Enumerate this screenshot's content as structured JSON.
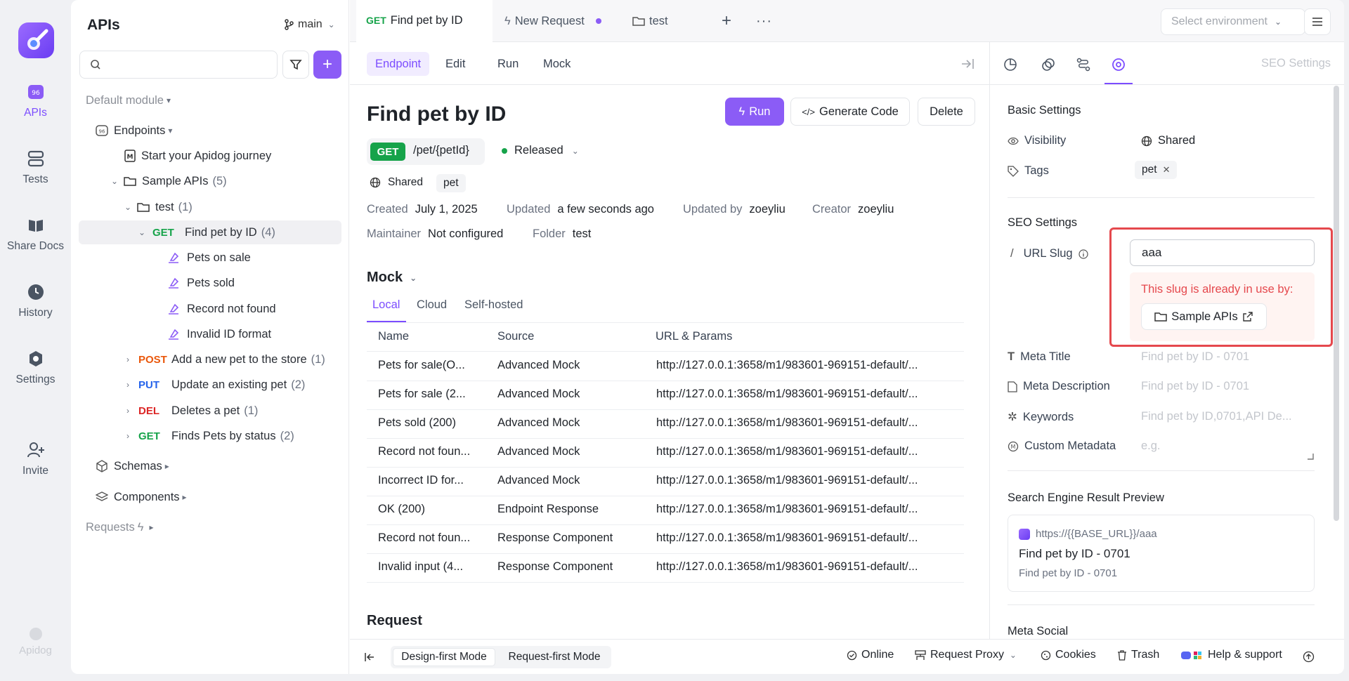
{
  "rail": {
    "items": [
      {
        "label": "APIs",
        "icon": "apis-icon"
      },
      {
        "label": "Tests",
        "icon": "tests-icon"
      },
      {
        "label": "Share Docs",
        "icon": "share-docs-icon"
      },
      {
        "label": "History",
        "icon": "history-icon"
      },
      {
        "label": "Settings",
        "icon": "settings-icon"
      },
      {
        "label": "Invite",
        "icon": "invite-icon"
      }
    ],
    "footer_label": "Apidog"
  },
  "sidebar": {
    "title": "APIs",
    "branch": "main",
    "tree": {
      "default_module": "Default module",
      "endpoints": "Endpoints",
      "journey": "Start your Apidog journey",
      "sample_apis": "Sample APIs",
      "sample_apis_count": "(5)",
      "test": "test",
      "test_count": "(1)",
      "selected_method": "GET",
      "selected_name": "Find pet by ID",
      "selected_count": "(4)",
      "cases": [
        "Pets on sale",
        "Pets sold",
        "Record not found",
        "Invalid ID format"
      ],
      "endpoints_list": [
        {
          "method": "POST",
          "name": "Add a new pet to the store",
          "count": "(1)"
        },
        {
          "method": "PUT",
          "name": "Update an existing pet",
          "count": "(2)"
        },
        {
          "method": "DEL",
          "name": "Deletes a pet",
          "count": "(1)"
        },
        {
          "method": "GET",
          "name": "Finds Pets by status",
          "count": "(2)"
        }
      ],
      "schemas": "Schemas",
      "components": "Components",
      "requests": "Requests"
    }
  },
  "tabs": [
    {
      "method": "GET",
      "label": "Find pet by ID"
    },
    {
      "label": "New Request"
    },
    {
      "label": "test"
    }
  ],
  "env_placeholder": "Select environment",
  "subtabs": [
    "Endpoint",
    "Edit",
    "Run",
    "Mock"
  ],
  "endpoint": {
    "title": "Find pet by ID",
    "run_label": "Run",
    "generate_label": "Generate Code",
    "delete_label": "Delete",
    "method": "GET",
    "path": "/pet/{petId}",
    "status": "Released",
    "visibility": "Shared",
    "tag": "pet",
    "created_k": "Created",
    "created_v": "July 1, 2025",
    "updated_k": "Updated",
    "updated_v": "a few seconds ago",
    "updatedby_k": "Updated by",
    "updatedby_v": "zoeyliu",
    "creator_k": "Creator",
    "creator_v": "zoeyliu",
    "maintainer_k": "Maintainer",
    "maintainer_v": "Not configured",
    "folder_k": "Folder",
    "folder_v": "test"
  },
  "mock": {
    "title": "Mock",
    "tabs": [
      "Local",
      "Cloud",
      "Self-hosted"
    ],
    "headers": [
      "Name",
      "Source",
      "URL & Params"
    ],
    "rows": [
      {
        "name": "Pets for sale(O...",
        "source": "Advanced Mock",
        "url": "http://127.0.0.1:3658/m1/983601-969151-default/..."
      },
      {
        "name": "Pets for sale (2...",
        "source": "Advanced Mock",
        "url": "http://127.0.0.1:3658/m1/983601-969151-default/..."
      },
      {
        "name": "Pets sold (200)",
        "source": "Advanced Mock",
        "url": "http://127.0.0.1:3658/m1/983601-969151-default/..."
      },
      {
        "name": "Record not foun...",
        "source": "Advanced Mock",
        "url": "http://127.0.0.1:3658/m1/983601-969151-default/..."
      },
      {
        "name": "Incorrect ID for...",
        "source": "Advanced Mock",
        "url": "http://127.0.0.1:3658/m1/983601-969151-default/..."
      },
      {
        "name": "OK (200)",
        "source": "Endpoint Response",
        "url": "http://127.0.0.1:3658/m1/983601-969151-default/..."
      },
      {
        "name": "Record not foun...",
        "source": "Response Component",
        "url": "http://127.0.0.1:3658/m1/983601-969151-default/..."
      },
      {
        "name": "Invalid input (4...",
        "source": "Response Component",
        "url": "http://127.0.0.1:3658/m1/983601-969151-default/..."
      }
    ]
  },
  "request_title": "Request",
  "right": {
    "header": "SEO Settings",
    "basic": "Basic Settings",
    "visibility_k": "Visibility",
    "visibility_v": "Shared",
    "tags_k": "Tags",
    "tag_v": "pet",
    "seo": "SEO Settings",
    "slug_k": "URL Slug",
    "slug_v": "aaa",
    "slug_warn": "This slug is already in use by:",
    "slug_link": "Sample APIs",
    "meta_title_k": "Meta Title",
    "meta_title_ph": "Find pet by ID - 0701",
    "meta_desc_k": "Meta Description",
    "meta_desc_ph": "Find pet by ID - 0701",
    "keywords_k": "Keywords",
    "keywords_ph": "Find pet by ID,0701,API De...",
    "custom_k": "Custom Metadata",
    "custom_ph": "e.g.",
    "preview_title": "Search Engine Result Preview",
    "preview_url": "https://{{BASE_URL}}/aaa",
    "preview_heading": "Find pet by ID - 0701",
    "preview_desc": "Find pet by ID - 0701",
    "meta_social": "Meta Social"
  },
  "footer": {
    "design_mode": "Design-first Mode",
    "request_mode": "Request-first Mode",
    "online": "Online",
    "proxy": "Request Proxy",
    "cookies": "Cookies",
    "trash": "Trash",
    "help": "Help & support"
  },
  "colors": {
    "accent": "#8b5cf6",
    "get": "#16a34a",
    "post": "#ea580c",
    "put": "#2563eb",
    "del": "#dc2626",
    "warn": "#e5484d"
  }
}
